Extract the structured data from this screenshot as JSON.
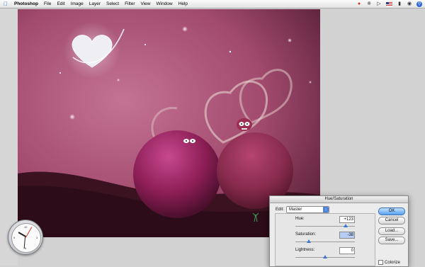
{
  "menubar": {
    "app_name": "Photoshop",
    "items": [
      "File",
      "Edit",
      "Image",
      "Layer",
      "Select",
      "Filter",
      "View",
      "Window",
      "Help"
    ],
    "tray": {
      "icons": [
        "ladybug-icon",
        "bluetooth-icon",
        "volume-icon",
        "flag-icon",
        "battery-icon",
        "user-icon",
        "spotlight-icon"
      ]
    }
  },
  "colors": {
    "accent": "#3f78d2",
    "canvas_pink": "#b85a7e",
    "canvas_dark": "#3a1220"
  },
  "dialog": {
    "title": "Hue/Saturation",
    "edit_label": "Edit:",
    "edit_value": "Master",
    "hue": {
      "label": "Hue:",
      "value": "+123"
    },
    "saturation": {
      "label": "Saturation:",
      "value": "-38"
    },
    "lightness": {
      "label": "Lightness:",
      "value": "0"
    },
    "buttons": {
      "ok": "OK",
      "cancel": "Cancel",
      "load": "Load...",
      "save": "Save..."
    },
    "colorize_label": "Colorize",
    "colorize_checked": false
  },
  "clock": {
    "numbers": [
      "12",
      "3",
      "6",
      "9"
    ]
  }
}
